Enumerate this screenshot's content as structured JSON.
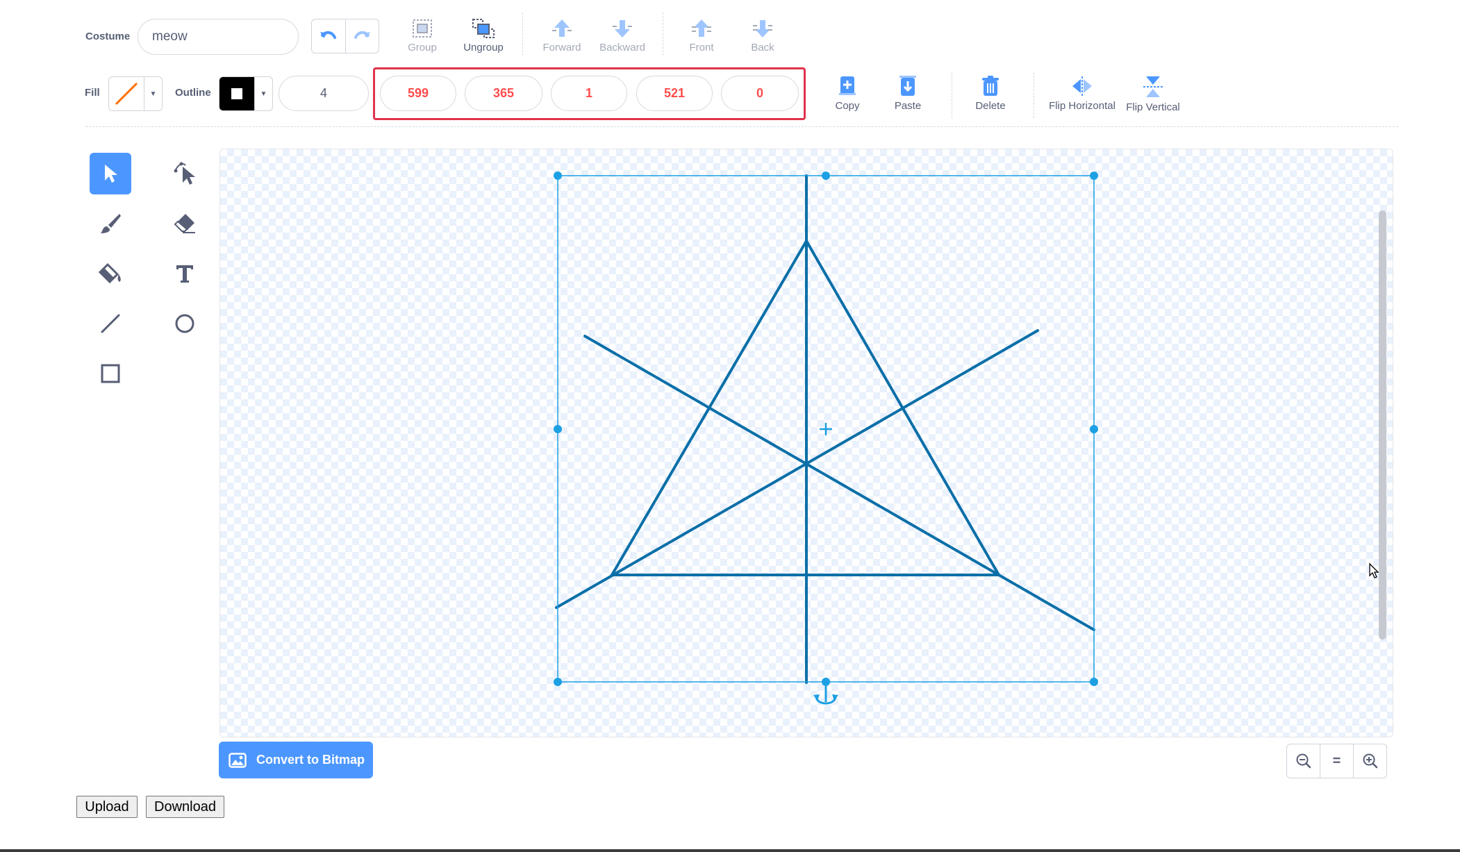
{
  "toolbar": {
    "costume_label": "Costume",
    "costume_name": "meow",
    "group_label": "Group",
    "ungroup_label": "Ungroup",
    "forward_label": "Forward",
    "backward_label": "Backward",
    "front_label": "Front",
    "back_label": "Back",
    "fill_label": "Fill",
    "outline_label": "Outline",
    "outline_width": "4",
    "coord_fields": [
      "599",
      "365",
      "1",
      "521",
      "0"
    ],
    "copy_label": "Copy",
    "paste_label": "Paste",
    "delete_label": "Delete",
    "flip_h_label": "Flip Horizontal",
    "flip_v_label": "Flip Vertical"
  },
  "tools": [
    "select-icon",
    "reshape-icon",
    "brush-icon",
    "eraser-icon",
    "fill-bucket-icon",
    "text-icon",
    "line-icon",
    "circle-icon",
    "rectangle-icon"
  ],
  "canvas": {
    "convert_label": "Convert to Bitmap",
    "zoom_reset_symbol": "="
  },
  "footer": {
    "upload_label": "Upload",
    "download_label": "Download"
  },
  "colors": {
    "accent": "#4c97ff",
    "highlight_box": "#e0334b",
    "red_text": "#ff4c4c",
    "selection": "#1ca0e3",
    "drawing_stroke": "#0b6fa8",
    "fill_swatch_line": "#ff6d00"
  }
}
